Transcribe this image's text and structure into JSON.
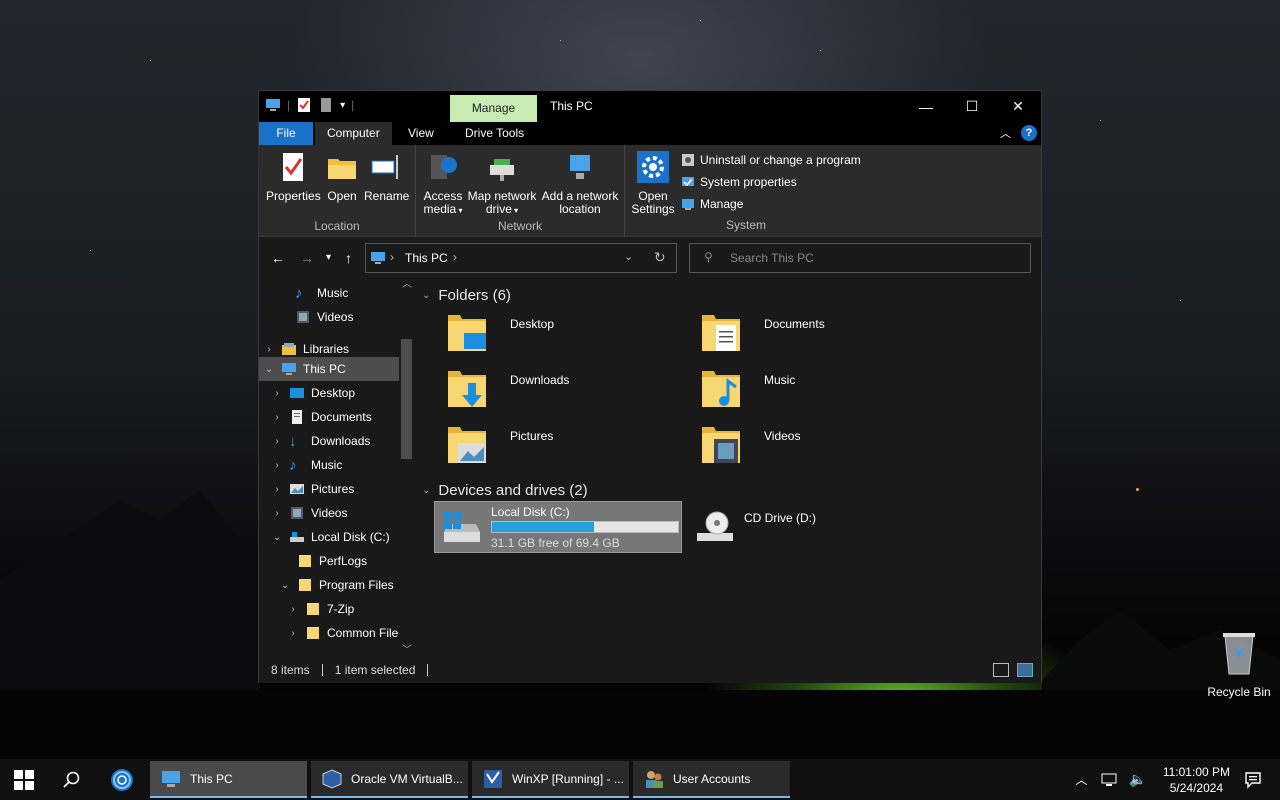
{
  "window": {
    "title": "This PC",
    "manage_tab": "Manage",
    "tabs": {
      "file": "File",
      "computer": "Computer",
      "view": "View",
      "drive_tools": "Drive Tools"
    }
  },
  "ribbon": {
    "location": {
      "label": "Location",
      "properties": "Properties",
      "open": "Open",
      "rename": "Rename"
    },
    "network": {
      "label": "Network",
      "access_media_1": "Access",
      "access_media_2": "media",
      "map_drive_1": "Map network",
      "map_drive_2": "drive",
      "add_loc_1": "Add a network",
      "add_loc_2": "location"
    },
    "system": {
      "label": "System",
      "open_settings_1": "Open",
      "open_settings_2": "Settings",
      "uninstall": "Uninstall or change a program",
      "sys_props": "System properties",
      "manage": "Manage"
    }
  },
  "address": {
    "path": "This PC",
    "search_placeholder": "Search This PC"
  },
  "sidebar": {
    "items": [
      {
        "label": "Music"
      },
      {
        "label": "Videos"
      },
      {
        "label": "Libraries"
      },
      {
        "label": "This PC"
      },
      {
        "label": "Desktop"
      },
      {
        "label": "Documents"
      },
      {
        "label": "Downloads"
      },
      {
        "label": "Music"
      },
      {
        "label": "Pictures"
      },
      {
        "label": "Videos"
      },
      {
        "label": "Local Disk (C:)"
      },
      {
        "label": "PerfLogs"
      },
      {
        "label": "Program Files"
      },
      {
        "label": "7-Zip"
      },
      {
        "label": "Common File"
      }
    ]
  },
  "content": {
    "folders_header": "Folders (6)",
    "folders": [
      {
        "label": "Desktop"
      },
      {
        "label": "Documents"
      },
      {
        "label": "Downloads"
      },
      {
        "label": "Music"
      },
      {
        "label": "Pictures"
      },
      {
        "label": "Videos"
      }
    ],
    "drives_header": "Devices and drives (2)",
    "drives": [
      {
        "name": "Local Disk (C:)",
        "free": "31.1 GB free of 69.4 GB",
        "used_fraction": 0.55
      },
      {
        "name": "CD Drive (D:)"
      }
    ]
  },
  "status": {
    "items": "8 items",
    "selected": "1 item selected"
  },
  "desktop": {
    "recycle_bin": "Recycle Bin"
  },
  "taskbar": {
    "apps": [
      {
        "label": "This PC"
      },
      {
        "label": "Oracle VM VirtualB..."
      },
      {
        "label": "WinXP [Running] - ..."
      },
      {
        "label": "User Accounts"
      }
    ],
    "time": "11:01:00 PM",
    "date": "5/24/2024"
  },
  "colors": {
    "accent": "#1a73c9",
    "manage_tab": "#c8ecb1",
    "progress": "#26a0da"
  }
}
